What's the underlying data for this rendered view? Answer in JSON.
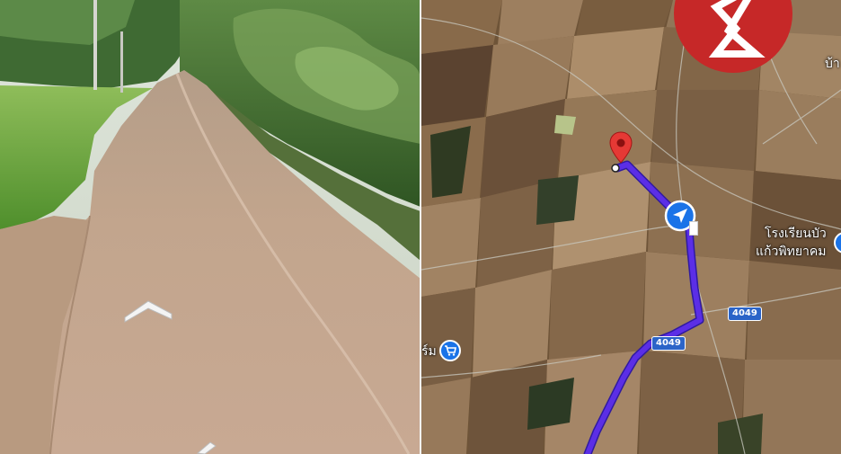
{
  "street_view": {
    "nav_arrows": [
      "forward-arrow",
      "backward-arrow"
    ]
  },
  "map": {
    "labels": {
      "school_line1": "โรงเรียนบัว",
      "school_line2": "แก้วพิทยาคม",
      "top_right_fragment": "บ้า",
      "left_fragment": "ร์ม"
    },
    "road_badges": {
      "badge_a": "4049",
      "badge_b": "4049"
    },
    "route_color": "#5b2ee6",
    "pin_color": "#e53935",
    "location_color": "#1a73e8",
    "logo_color": "#c62828"
  }
}
